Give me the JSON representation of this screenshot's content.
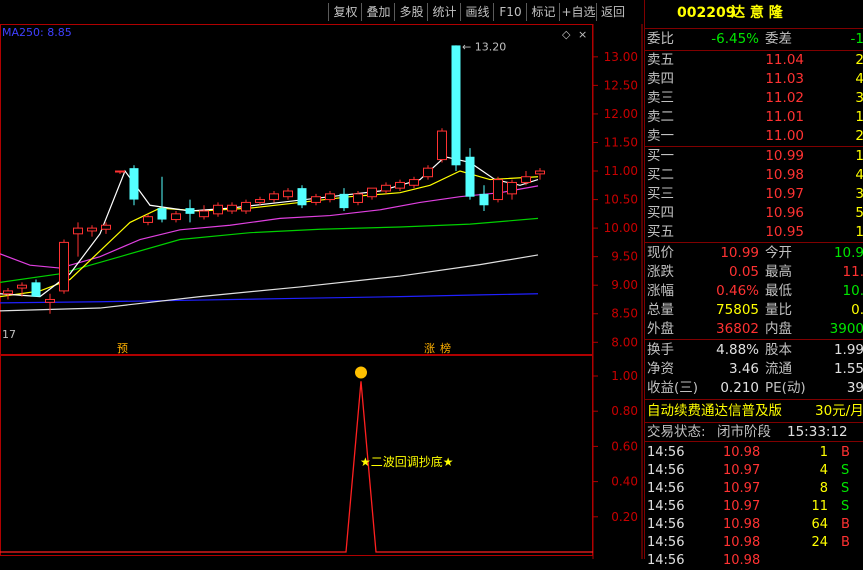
{
  "toolbar": {
    "buttons": [
      "复权",
      "叠加",
      "多股",
      "统计",
      "画线",
      "F10",
      "标记",
      "+自选",
      "返回"
    ]
  },
  "main_chart": {
    "ma_label": "MA250: 8.85",
    "peak_label": "13.20",
    "left_label": "17",
    "y_ticks": [
      "13.00",
      "12.50",
      "12.00",
      "11.50",
      "11.00",
      "10.50",
      "10.00",
      "9.50",
      "9.00",
      "8.50",
      "8.00"
    ],
    "markers": [
      "预",
      "涨",
      "榜"
    ]
  },
  "sub_chart": {
    "y_ticks": [
      "1.00",
      "0.80",
      "0.60",
      "0.40",
      "0.20"
    ],
    "signal_label": "★二波回调抄底★"
  },
  "chart_data": {
    "type": "candlestick",
    "ylim": [
      7.9,
      13.4
    ],
    "candles": [
      {
        "o": 8.85,
        "h": 8.95,
        "l": 8.75,
        "c": 8.9
      },
      {
        "o": 8.95,
        "h": 9.05,
        "l": 8.8,
        "c": 9.0
      },
      {
        "o": 9.05,
        "h": 9.1,
        "l": 8.8,
        "c": 8.8
      },
      {
        "o": 8.7,
        "h": 8.85,
        "l": 8.5,
        "c": 8.75
      },
      {
        "o": 8.9,
        "h": 9.8,
        "l": 8.85,
        "c": 9.75
      },
      {
        "o": 9.9,
        "h": 10.1,
        "l": 9.5,
        "c": 10.0
      },
      {
        "o": 9.95,
        "h": 10.05,
        "l": 9.85,
        "c": 10.0
      },
      {
        "o": 9.98,
        "h": 10.1,
        "l": 9.9,
        "c": 10.05
      },
      {
        "o": 11.0,
        "h": 11.0,
        "l": 10.95,
        "c": 11.0
      },
      {
        "o": 11.05,
        "h": 11.1,
        "l": 10.4,
        "c": 10.5
      },
      {
        "o": 10.1,
        "h": 10.25,
        "l": 10.05,
        "c": 10.2
      },
      {
        "o": 10.35,
        "h": 10.9,
        "l": 10.1,
        "c": 10.15
      },
      {
        "o": 10.15,
        "h": 10.3,
        "l": 10.1,
        "c": 10.25
      },
      {
        "o": 10.35,
        "h": 10.5,
        "l": 10.1,
        "c": 10.25
      },
      {
        "o": 10.2,
        "h": 10.4,
        "l": 10.15,
        "c": 10.3
      },
      {
        "o": 10.25,
        "h": 10.45,
        "l": 10.2,
        "c": 10.4
      },
      {
        "o": 10.3,
        "h": 10.45,
        "l": 10.25,
        "c": 10.4
      },
      {
        "o": 10.3,
        "h": 10.5,
        "l": 10.25,
        "c": 10.45
      },
      {
        "o": 10.45,
        "h": 10.55,
        "l": 10.4,
        "c": 10.5
      },
      {
        "o": 10.5,
        "h": 10.65,
        "l": 10.45,
        "c": 10.6
      },
      {
        "o": 10.55,
        "h": 10.7,
        "l": 10.5,
        "c": 10.65
      },
      {
        "o": 10.7,
        "h": 10.75,
        "l": 10.35,
        "c": 10.4
      },
      {
        "o": 10.45,
        "h": 10.6,
        "l": 10.4,
        "c": 10.55
      },
      {
        "o": 10.5,
        "h": 10.65,
        "l": 10.45,
        "c": 10.6
      },
      {
        "o": 10.6,
        "h": 10.7,
        "l": 10.3,
        "c": 10.35
      },
      {
        "o": 10.45,
        "h": 10.65,
        "l": 10.4,
        "c": 10.6
      },
      {
        "o": 10.55,
        "h": 10.7,
        "l": 10.5,
        "c": 10.7
      },
      {
        "o": 10.65,
        "h": 10.8,
        "l": 10.6,
        "c": 10.75
      },
      {
        "o": 10.7,
        "h": 10.85,
        "l": 10.65,
        "c": 10.8
      },
      {
        "o": 10.75,
        "h": 10.9,
        "l": 10.7,
        "c": 10.85
      },
      {
        "o": 10.9,
        "h": 11.1,
        "l": 10.85,
        "c": 11.05
      },
      {
        "o": 11.2,
        "h": 11.75,
        "l": 11.15,
        "c": 11.7
      },
      {
        "o": 13.2,
        "h": 13.2,
        "l": 11.0,
        "c": 11.1
      },
      {
        "o": 11.25,
        "h": 11.4,
        "l": 10.5,
        "c": 10.55
      },
      {
        "o": 10.6,
        "h": 10.75,
        "l": 10.3,
        "c": 10.4
      },
      {
        "o": 10.5,
        "h": 10.9,
        "l": 10.45,
        "c": 10.85
      },
      {
        "o": 10.6,
        "h": 10.85,
        "l": 10.5,
        "c": 10.8
      },
      {
        "o": 10.8,
        "h": 11.0,
        "l": 10.75,
        "c": 10.9
      },
      {
        "o": 10.95,
        "h": 11.05,
        "l": 10.85,
        "c": 11.0
      }
    ]
  },
  "quote": {
    "code": "002209",
    "name": "达 意 隆",
    "weibi_label": "委比",
    "weibi_value": "-6.45%",
    "weicha_label": "委差",
    "weicha_value": "-1",
    "asks": [
      {
        "label": "卖五",
        "price": "11.04",
        "vol": "2"
      },
      {
        "label": "卖四",
        "price": "11.03",
        "vol": "4"
      },
      {
        "label": "卖三",
        "price": "11.02",
        "vol": "3"
      },
      {
        "label": "卖二",
        "price": "11.01",
        "vol": "1"
      },
      {
        "label": "卖一",
        "price": "11.00",
        "vol": "2"
      }
    ],
    "bids": [
      {
        "label": "买一",
        "price": "10.99",
        "vol": "1"
      },
      {
        "label": "买二",
        "price": "10.98",
        "vol": "4"
      },
      {
        "label": "买三",
        "price": "10.97",
        "vol": "3"
      },
      {
        "label": "买四",
        "price": "10.96",
        "vol": "5"
      },
      {
        "label": "买五",
        "price": "10.95",
        "vol": "1"
      }
    ],
    "stats": [
      {
        "l1": "现价",
        "v1": "10.99",
        "c1": "red",
        "l2": "今开",
        "v2": "10.9",
        "c2": "green"
      },
      {
        "l1": "涨跌",
        "v1": "0.05",
        "c1": "red",
        "l2": "最高",
        "v2": "11.",
        "c2": "red"
      },
      {
        "l1": "涨幅",
        "v1": "0.46%",
        "c1": "red",
        "l2": "最低",
        "v2": "10.",
        "c2": "green"
      },
      {
        "l1": "总量",
        "v1": "75805",
        "c1": "yellow",
        "l2": "量比",
        "v2": "0.",
        "c2": "yellow"
      },
      {
        "l1": "外盘",
        "v1": "36802",
        "c1": "red",
        "l2": "内盘",
        "v2": "3900",
        "c2": "green"
      }
    ],
    "stats2": [
      {
        "l1": "换手",
        "v1": "4.88%",
        "l2": "股本",
        "v2": "1.99"
      },
      {
        "l1": "净资",
        "v1": "3.46",
        "l2": "流通",
        "v2": "1.55"
      },
      {
        "l1": "收益(三)",
        "v1": "0.210",
        "l2": "PE(动)",
        "v2": "39"
      }
    ],
    "banner": "自动续费通达信普及版",
    "banner_price": "30元/月",
    "status_label": "交易状态:",
    "status_value": "闭市阶段",
    "status_time": "15:33:12",
    "trades": [
      {
        "t": "14:56",
        "p": "10.98",
        "v": "1",
        "s": "B"
      },
      {
        "t": "14:56",
        "p": "10.97",
        "v": "4",
        "s": "S"
      },
      {
        "t": "14:56",
        "p": "10.97",
        "v": "8",
        "s": "S"
      },
      {
        "t": "14:56",
        "p": "10.97",
        "v": "11",
        "s": "S"
      },
      {
        "t": "14:56",
        "p": "10.98",
        "v": "64",
        "s": "B"
      },
      {
        "t": "14:56",
        "p": "10.98",
        "v": "24",
        "s": "B"
      },
      {
        "t": "14:56",
        "p": "10.98",
        "v": "",
        "s": ""
      }
    ]
  }
}
